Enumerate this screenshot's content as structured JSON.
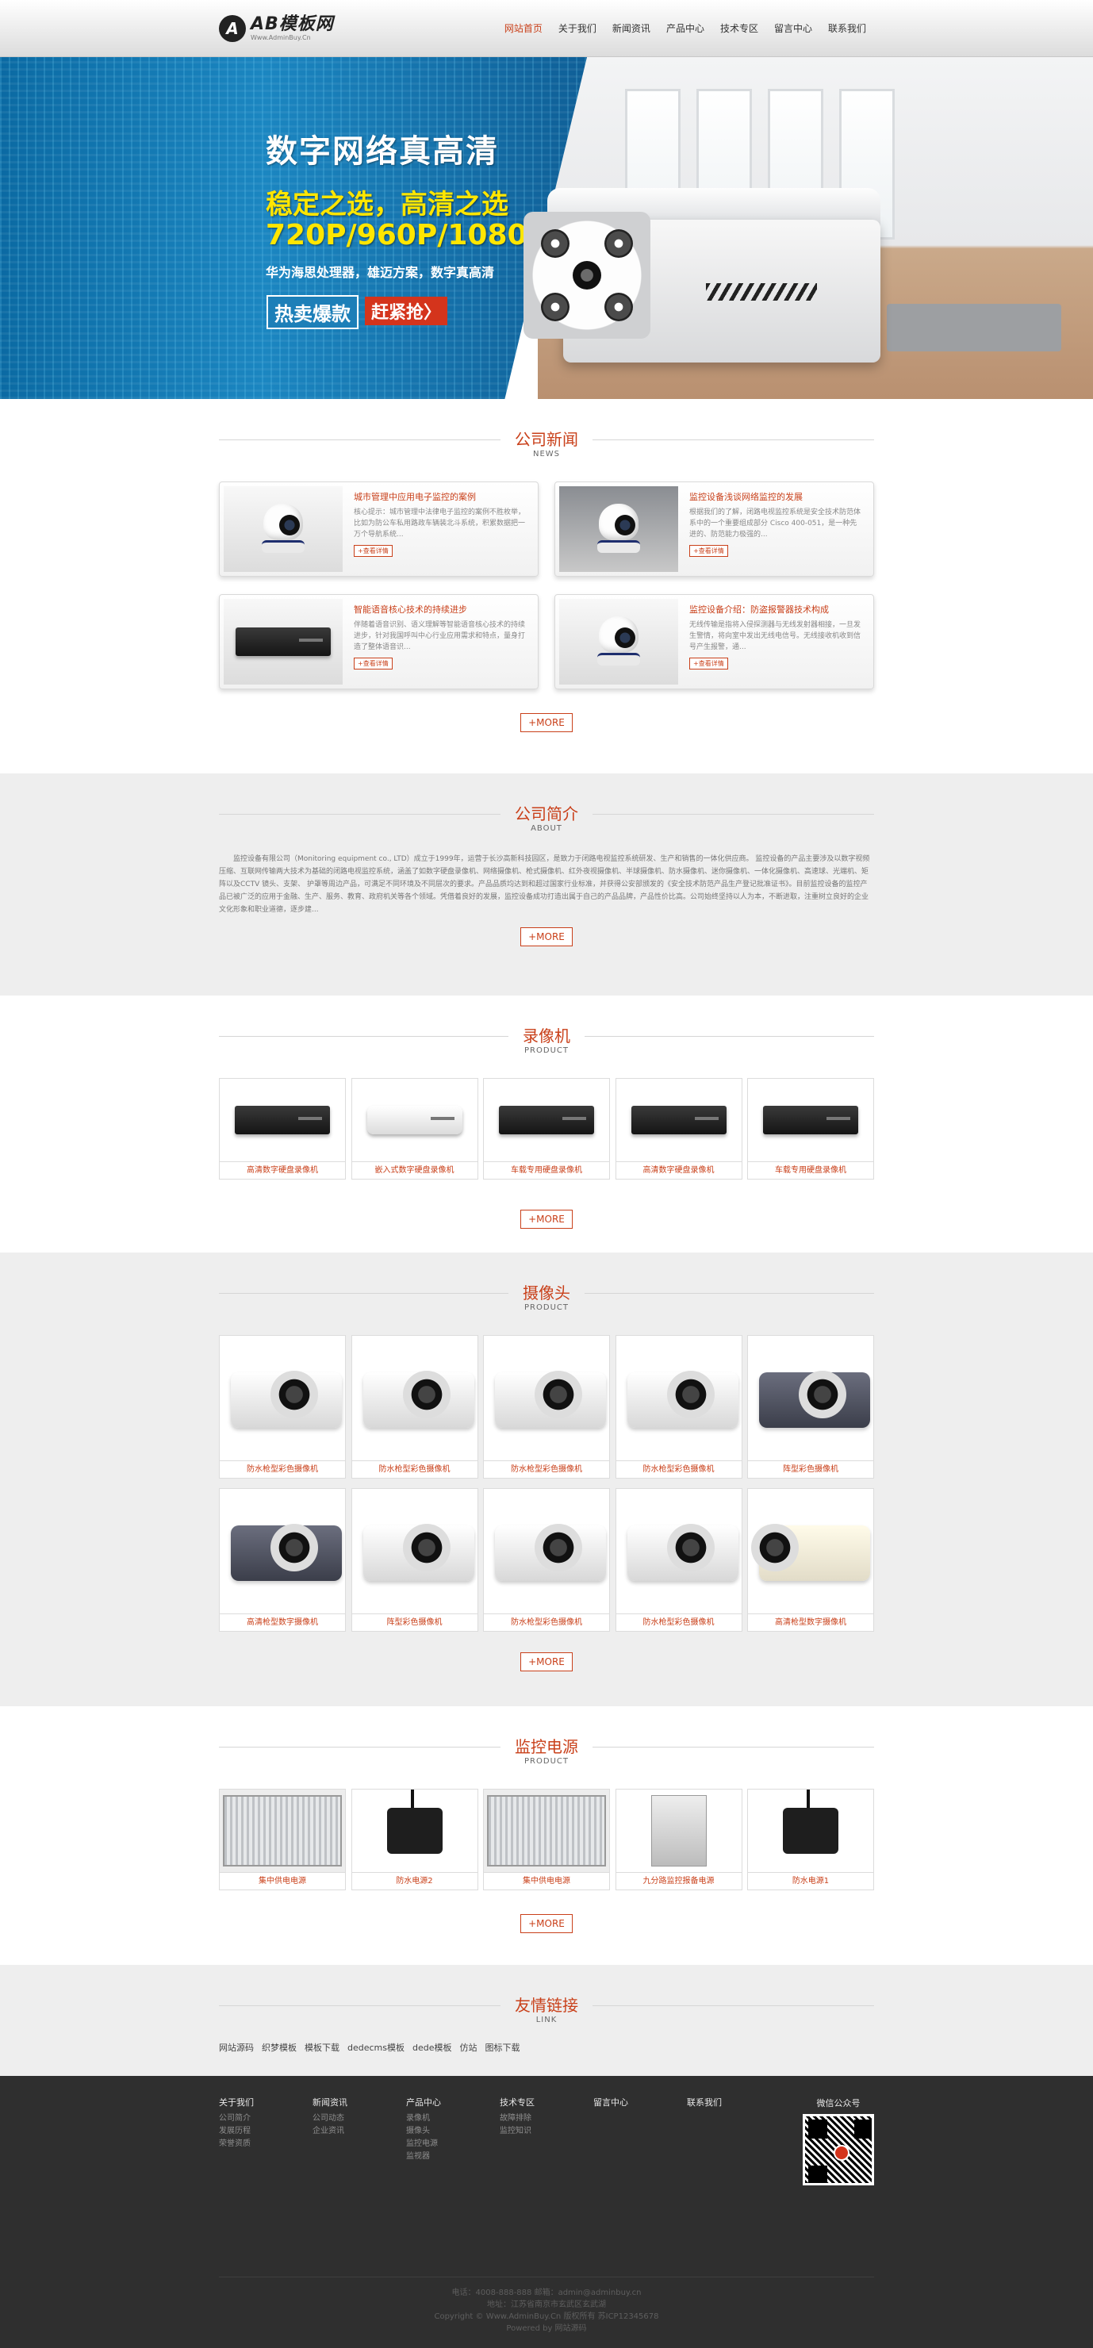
{
  "header": {
    "logo_name": "AB模板网",
    "logo_sub": "Www.AdminBuy.Cn",
    "nav": [
      "网站首页",
      "关于我们",
      "新闻资讯",
      "产品中心",
      "技术专区",
      "留言中心",
      "联系我们"
    ]
  },
  "banner": {
    "title": "数字网络真高清",
    "slogan": "稳定之选，高清之选",
    "resolution": "720P/960P/1080P",
    "desc": "华为海思处理器，雄迈方案，数字真高清",
    "btn_hot": "热卖爆款",
    "btn_buy": "赶紧抢〉"
  },
  "news": {
    "title": "公司新闻",
    "sub": "NEWS",
    "items": [
      {
        "title": "城市管理中应用电子监控的案例",
        "desc": "核心提示：城市管理中法律电子监控的案例不胜枚举，比如为防公车私用路政车辆装北斗系统，积累数据把一万个导航系统...",
        "more": "+查看详情"
      },
      {
        "title": "监控设备浅谈网络监控的发展",
        "desc": "根据我们的了解，闭路电视监控系统是安全技术防范体系中的一个重要组成部分 Cisco 400-051，是一种先进的、防范能力极强的...",
        "more": "+查看详情"
      },
      {
        "title": "智能语音核心技术的持续进步",
        "desc": "伴随着语音识别、语义理解等智能语音核心技术的持续进步，针对我国呼叫中心行业应用需求和特点，量身打造了整体语音识...",
        "more": "+查看详情"
      },
      {
        "title": "监控设备介绍：防盗报警器技术构成",
        "desc": "无线传输是指将入侵探测器与无线发射器相接，一旦发生警情，将向室中发出无线电信号。无线接收机收到信号产生报警，通...",
        "more": "+查看详情"
      }
    ],
    "more": "+MORE"
  },
  "about": {
    "title": "公司简介",
    "sub": "ABOUT",
    "text": "监控设备有限公司（Monitoring equipment co., LTD）成立于1999年，运营于长沙高新科技园区，是致力于闭路电视监控系统研发、生产和销售的一体化供应商。 监控设备的产品主要涉及以数字视频压缩、互联网传输两大技术为基础的闭路电视监控系统，涵盖了如数字硬盘录像机、网络摄像机、枪式摄像机、红外夜视摄像机、半球摄像机、防水摄像机、迷你摄像机、一体化摄像机、高速球、光端机、矩阵以及CCTV 镜头、支架、 护罩等周边产品，可满足不同环境及不同层次的要求。产品品质均达到和超过国家行业标准，并获得公安部颁发的《安全技术防范产品生产登记批准证书》。目前监控设备的监控产品已被广泛的应用于金融、生产、服务、教育、政府机关等各个领域。凭借着良好的发展，监控设备成功打造出属于自己的产品品牌，产品性价比高。公司始终坚持以人为本，不断进取，注重树立良好的企业文化形象和职业道德，逐步建...",
    "more": "+MORE"
  },
  "recorders": {
    "title": "录像机",
    "sub": "PRODUCT",
    "items": [
      "高清数字硬盘录像机",
      "嵌入式数字硬盘录像机",
      "车载专用硬盘录像机",
      "高清数字硬盘录像机",
      "车载专用硬盘录像机"
    ],
    "more": "+MORE"
  },
  "cameras": {
    "title": "摄像头",
    "sub": "PRODUCT",
    "row1": [
      "防水枪型彩色摄像机",
      "防水枪型彩色摄像机",
      "防水枪型彩色摄像机",
      "防水枪型彩色摄像机",
      "阵型彩色摄像机"
    ],
    "row2": [
      "高清枪型数字摄像机",
      "阵型彩色摄像机",
      "防水枪型彩色摄像机",
      "防水枪型彩色摄像机",
      "高清枪型数字摄像机"
    ],
    "more": "+MORE"
  },
  "power": {
    "title": "监控电源",
    "sub": "PRODUCT",
    "items": [
      "集中供电电源",
      "防水电源2",
      "集中供电电源",
      "九分路监控报备电源",
      "防水电源1"
    ],
    "more": "+MORE"
  },
  "links": {
    "title": "友情链接",
    "sub": "LINK",
    "items": [
      "网站源码",
      "织梦模板",
      "模板下载",
      "dedecms模板",
      "dede模板",
      "仿站",
      "图标下载"
    ]
  },
  "footer": {
    "cols": [
      {
        "title": "关于我们",
        "items": [
          "公司简介",
          "发展历程",
          "荣誉资质"
        ]
      },
      {
        "title": "新闻资讯",
        "items": [
          "公司动态",
          "企业资讯"
        ]
      },
      {
        "title": "产品中心",
        "items": [
          "录像机",
          "摄像头",
          "监控电源",
          "监视器"
        ]
      },
      {
        "title": "技术专区",
        "items": [
          "故障排除",
          "监控知识"
        ]
      },
      {
        "title": "留言中心",
        "items": []
      },
      {
        "title": "联系我们",
        "items": []
      }
    ],
    "wechat": "微信公众号",
    "line1": "电话：4008-888-888 邮箱：admin@adminbuy.cn",
    "line2": "地址：江苏省南京市玄武区玄武湖",
    "line3": "Copyright © Www.AdminBuy.Cn 版权所有 苏ICP12345678",
    "line4": "Powered by 网站源码"
  }
}
